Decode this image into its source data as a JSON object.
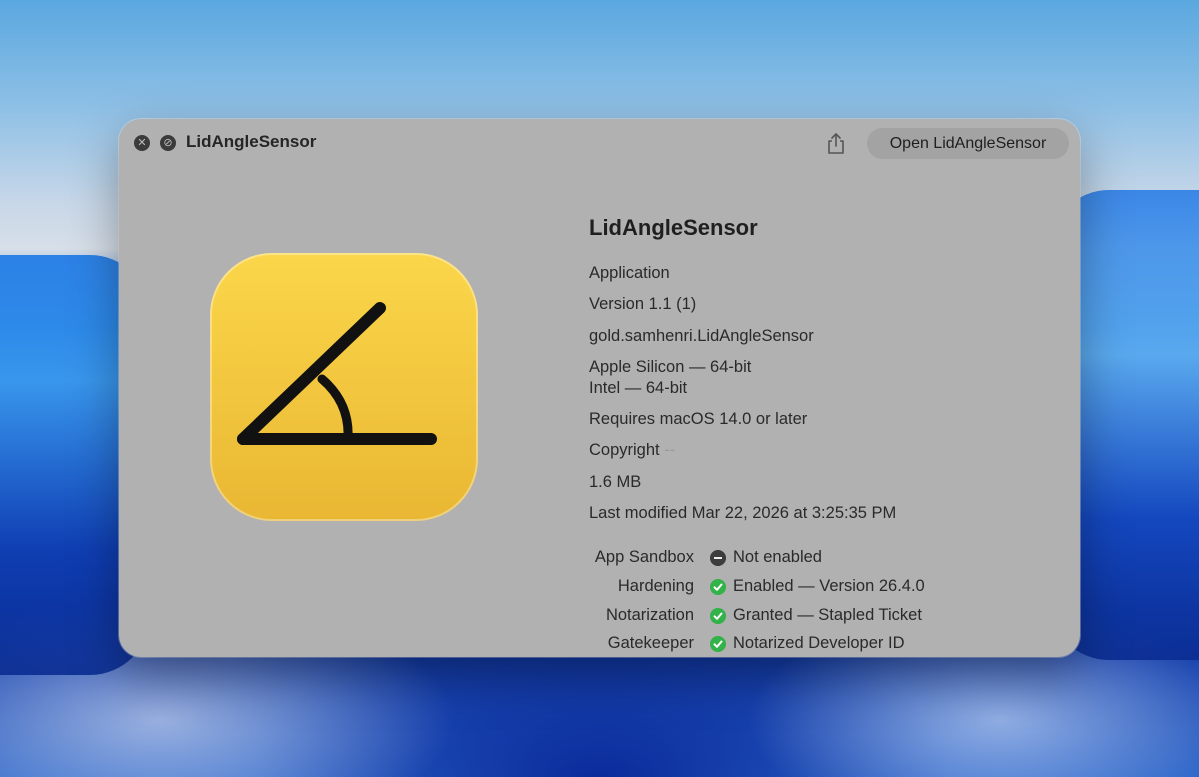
{
  "window": {
    "title": "LidAngleSensor",
    "open_button": "Open LidAngleSensor",
    "close_icon": "close-icon",
    "block_icon": "block-icon",
    "share_icon": "share-icon"
  },
  "app": {
    "name": "LidAngleSensor",
    "kind": "Application",
    "version": "Version 1.1 (1)",
    "bundle_id": "gold.samhenri.LidAngleSensor",
    "arch_1": "Apple Silicon — 64-bit",
    "arch_2": "Intel — 64-bit",
    "requires": "Requires macOS 14.0 or later",
    "copyright_label": "Copyright",
    "copyright_value": "--",
    "size": "1.6 MB",
    "modified": "Last modified Mar 22, 2026 at 3:25:35 PM",
    "icon_color": "#F5C93A"
  },
  "security": [
    {
      "label": "App Sandbox",
      "status": "disabled",
      "value": "Not enabled"
    },
    {
      "label": "Hardening",
      "status": "ok",
      "value": "Enabled — Version 26.4.0"
    },
    {
      "label": "Notarization",
      "status": "ok",
      "value": "Granted — Stapled Ticket"
    },
    {
      "label": "Gatekeeper",
      "status": "ok",
      "value": "Notarized Developer ID"
    }
  ]
}
